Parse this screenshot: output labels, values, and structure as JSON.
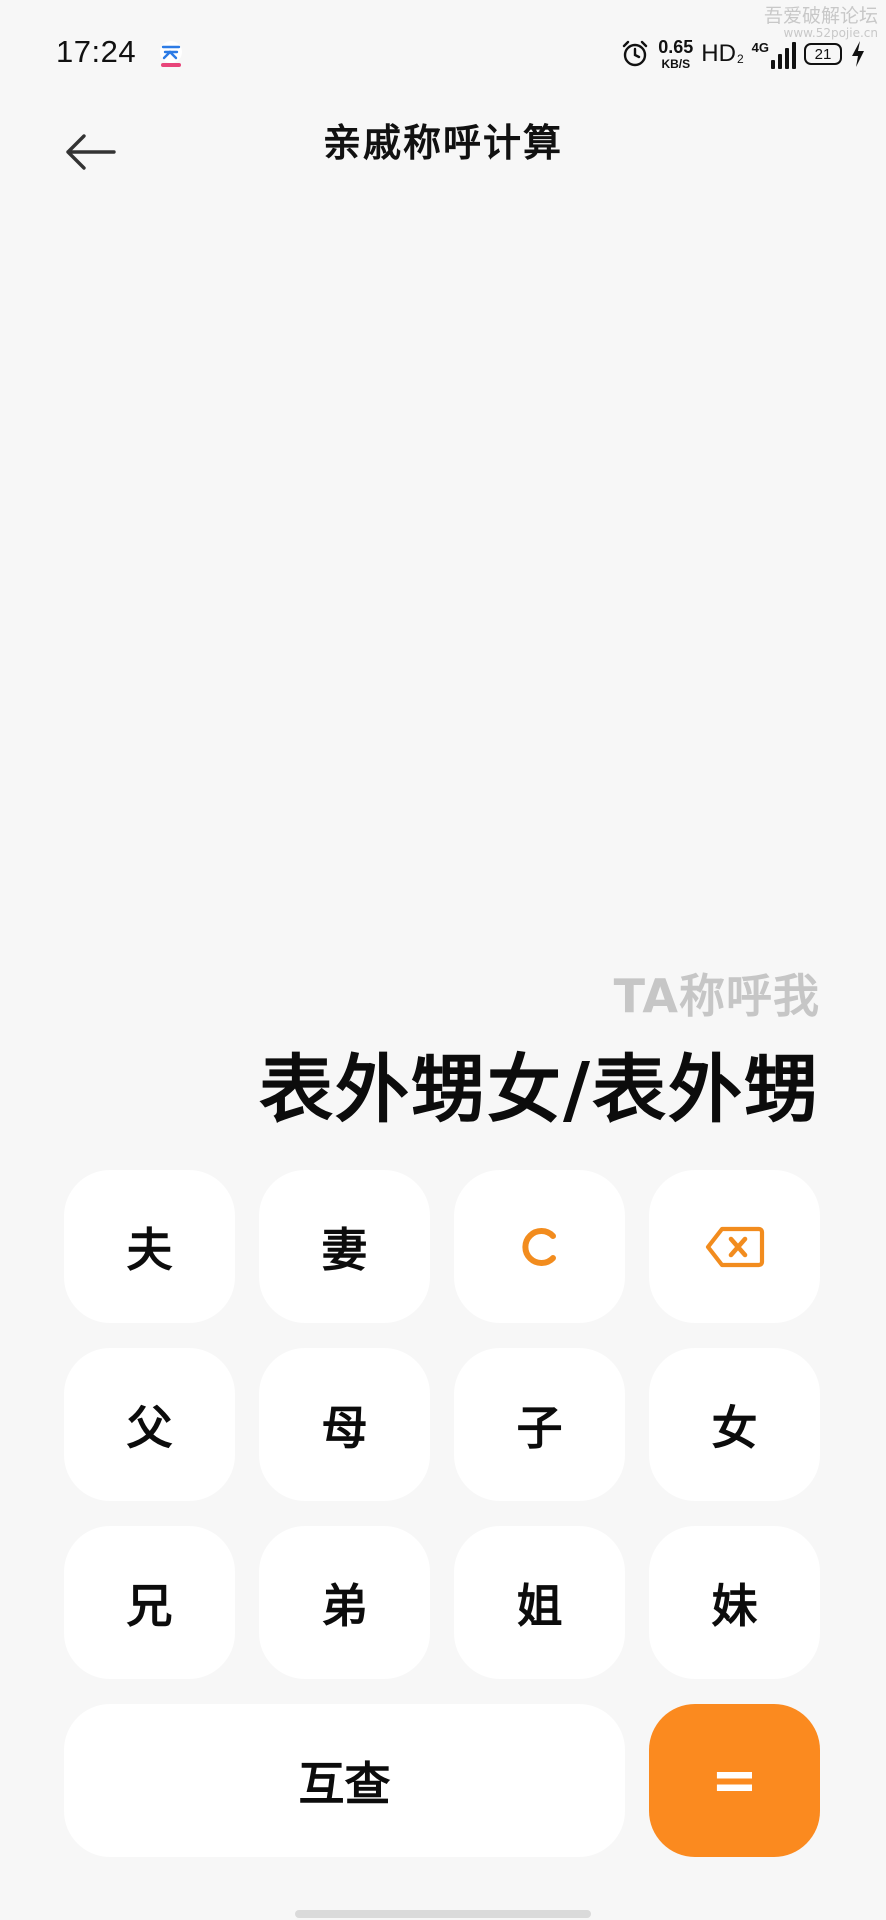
{
  "status_bar": {
    "time": "17:24",
    "speed_value": "0.65",
    "speed_unit": "KB/S",
    "hd_label": "HD",
    "hd_sub": "2",
    "network_type": "4G",
    "battery_level": "21",
    "icons": [
      "app-icon",
      "alarm-icon",
      "signal-icon",
      "battery-icon",
      "charging-icon"
    ]
  },
  "watermark": {
    "title": "吾爱破解论坛",
    "url": "www.52pojie.cn"
  },
  "header": {
    "title": "亲戚称呼计算",
    "back_icon": "arrow-left-icon"
  },
  "result": {
    "label": "TA称呼我",
    "value": "表外甥女/表外甥"
  },
  "keypad": {
    "row1": {
      "husband": "夫",
      "wife": "妻",
      "clear": "C",
      "delete_icon": "backspace-icon"
    },
    "row2": {
      "father": "父",
      "mother": "母",
      "son": "子",
      "daughter": "女"
    },
    "row3": {
      "elder_brother": "兄",
      "younger_brother": "弟",
      "elder_sister": "姐",
      "younger_sister": "妹"
    },
    "row4": {
      "mutual": "互查",
      "equals": "="
    }
  },
  "colors": {
    "accent": "#fb8a1f",
    "accent_text": "#f28c1e",
    "background": "#f7f7f7",
    "key_background": "#ffffff",
    "result_label": "#c6c6c6"
  }
}
